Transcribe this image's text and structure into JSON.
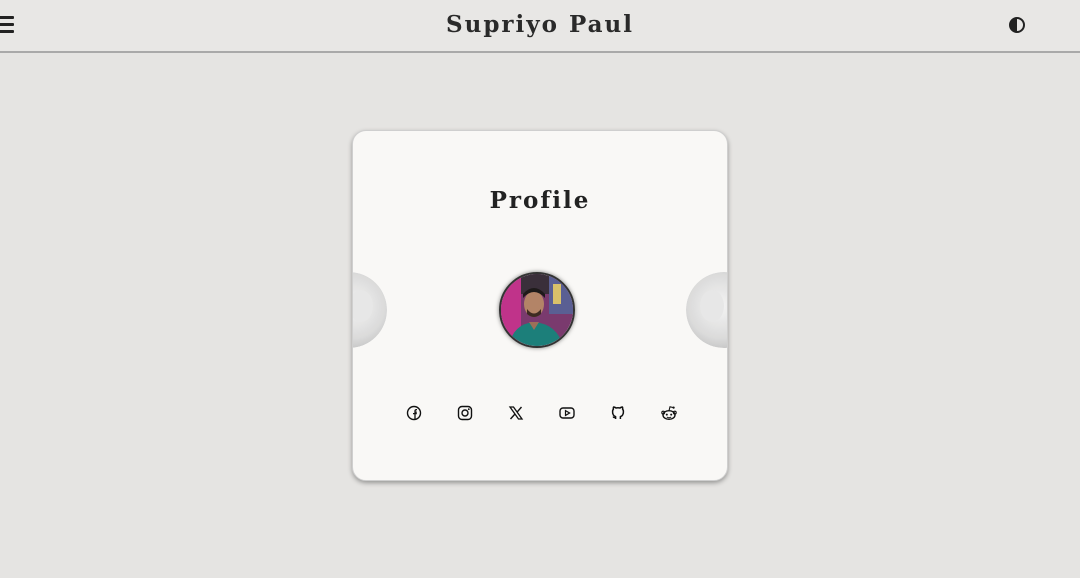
{
  "header": {
    "title": "Supriyo Paul",
    "menu_icon": "hamburger-icon",
    "theme_icon": "contrast-icon"
  },
  "card": {
    "title": "Profile",
    "avatar_icon": "profile-photo",
    "socials": [
      {
        "name": "facebook",
        "icon": "facebook-icon"
      },
      {
        "name": "instagram",
        "icon": "instagram-icon"
      },
      {
        "name": "x",
        "icon": "x-icon"
      },
      {
        "name": "youtube",
        "icon": "youtube-icon"
      },
      {
        "name": "github",
        "icon": "github-icon"
      },
      {
        "name": "reddit",
        "icon": "reddit-icon"
      }
    ]
  },
  "colors": {
    "background": "#e5e4e2",
    "card": "#f9f8f6",
    "text": "#222222"
  }
}
